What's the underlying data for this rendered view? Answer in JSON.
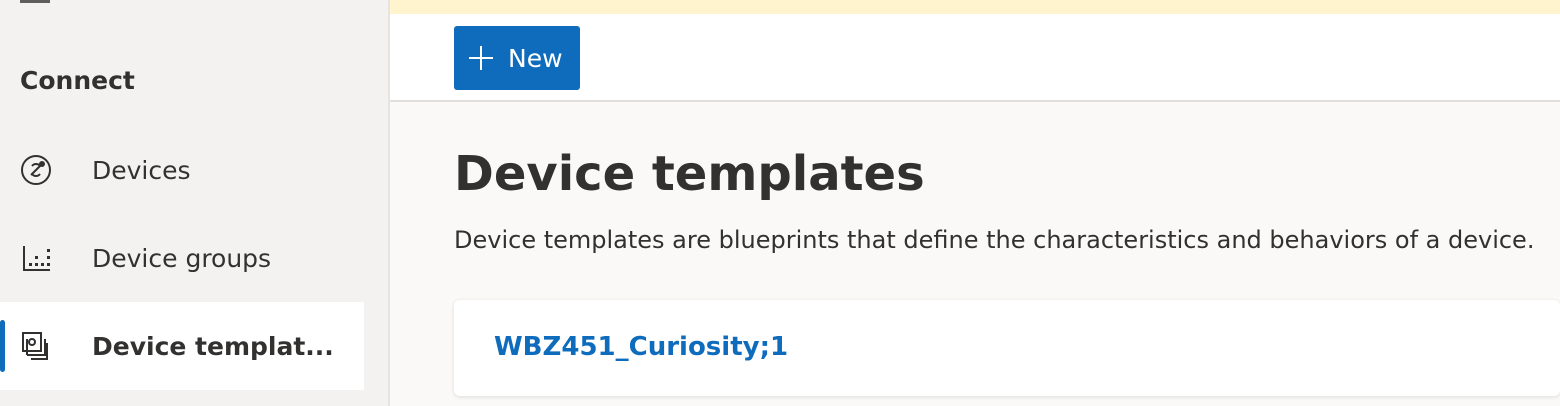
{
  "sidebar": {
    "section_heading": "Connect",
    "items": [
      {
        "label": "Devices",
        "icon": "devices-icon",
        "selected": false
      },
      {
        "label": "Device groups",
        "icon": "device-groups-icon",
        "selected": false
      },
      {
        "label": "Device templat...",
        "icon": "device-templates-icon",
        "selected": true
      }
    ]
  },
  "toolbar": {
    "new_label": "New",
    "new_icon": "plus-icon"
  },
  "main": {
    "title": "Device templates",
    "description": "Device templates are blueprints that define the characteristics and behaviors of a device.",
    "templates": [
      {
        "name": "WBZ451_Curiosity;1"
      }
    ]
  },
  "colors": {
    "accent": "#0f6cbd",
    "banner": "#fff4ce",
    "sidebar_bg": "#f3f2f1",
    "page_bg": "#faf9f8"
  }
}
